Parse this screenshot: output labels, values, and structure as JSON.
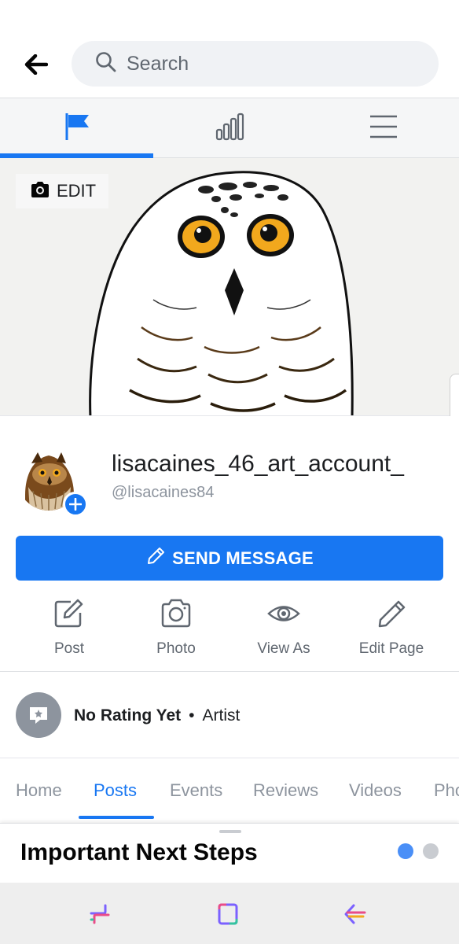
{
  "header": {
    "search_placeholder": "Search"
  },
  "page_tabs": [
    "flag-icon",
    "bar-chart-icon",
    "menu-icon"
  ],
  "cover": {
    "edit_label": "EDIT"
  },
  "profile": {
    "name": "lisacaines_46_art_account_",
    "handle": "@lisacaines84",
    "send_message_label": "SEND MESSAGE",
    "actions": [
      {
        "label": "Post",
        "icon": "compose-icon"
      },
      {
        "label": "Photo",
        "icon": "camera-icon"
      },
      {
        "label": "View As",
        "icon": "eye-icon"
      },
      {
        "label": "Edit Page",
        "icon": "pencil-icon"
      }
    ]
  },
  "rating": {
    "status": "No Rating Yet",
    "separator": "•",
    "category": "Artist"
  },
  "subnav": {
    "items": [
      "Home",
      "Posts",
      "Events",
      "Reviews",
      "Videos",
      "Photos"
    ],
    "active": "Posts"
  },
  "next_steps": {
    "title": "Important Next Steps",
    "dots": 2,
    "active_dot": 0
  },
  "colors": {
    "accent": "#1877f2",
    "muted": "#8d949e",
    "dot_inactive": "#c9ccd1"
  }
}
